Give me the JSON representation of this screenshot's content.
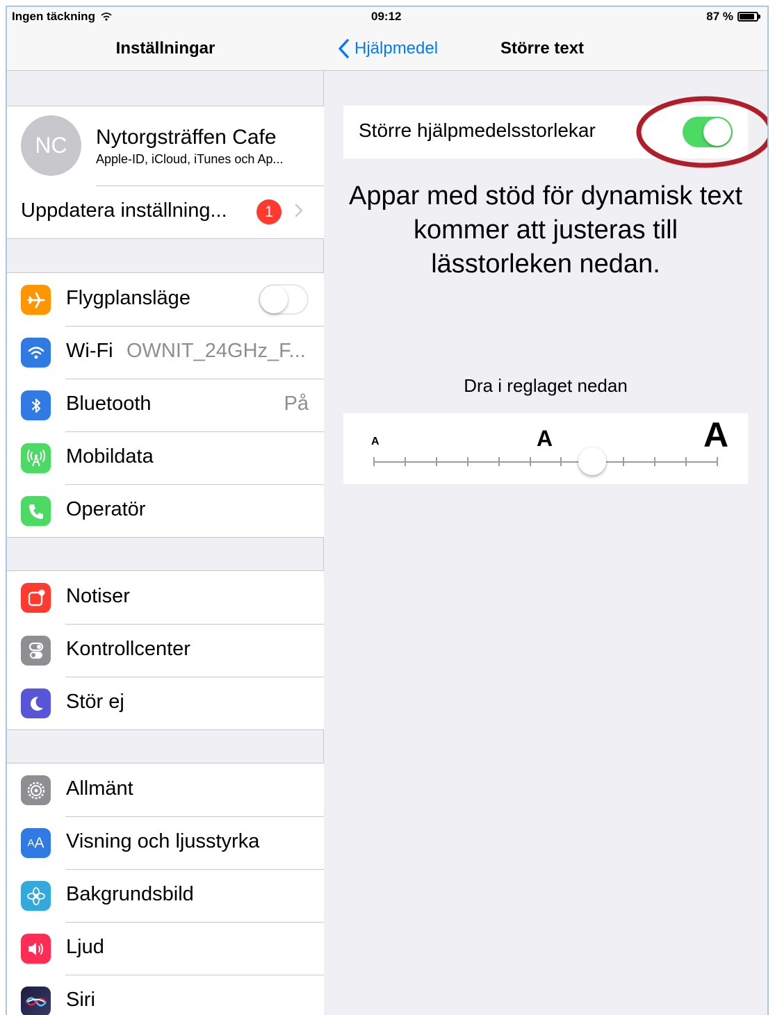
{
  "status": {
    "carrier": "Ingen täckning",
    "time": "09:12",
    "battery_percent": "87 %",
    "battery_level": 0.87
  },
  "sidebar": {
    "title": "Inställningar",
    "profile": {
      "initials": "NC",
      "name": "Nytorgsträffen Cafe",
      "subtitle": "Apple-ID, iCloud, iTunes och Ap..."
    },
    "update": {
      "label": "Uppdatera inställning...",
      "badge": "1"
    },
    "groups": [
      [
        {
          "id": "airplane",
          "label": "Flygplansläge",
          "icon": "airplane-icon",
          "color": "#ff9500",
          "toggle": false
        },
        {
          "id": "wifi",
          "label": "Wi-Fi",
          "value": "OWNIT_24GHz_F...",
          "icon": "wifi-icon",
          "color": "#2f7be3"
        },
        {
          "id": "bluetooth",
          "label": "Bluetooth",
          "value": "På",
          "icon": "bluetooth-icon",
          "color": "#2f7be3"
        },
        {
          "id": "mobildata",
          "label": "Mobildata",
          "icon": "antenna-icon",
          "color": "#4cd964"
        },
        {
          "id": "operator",
          "label": "Operatör",
          "icon": "phone-icon",
          "color": "#4cd964"
        }
      ],
      [
        {
          "id": "notiser",
          "label": "Notiser",
          "icon": "notification-icon",
          "color": "#ff3b30"
        },
        {
          "id": "kontrollcenter",
          "label": "Kontrollcenter",
          "icon": "control-center-icon",
          "color": "#8e8e93"
        },
        {
          "id": "storej",
          "label": "Stör ej",
          "icon": "moon-icon",
          "color": "#5856d6"
        }
      ],
      [
        {
          "id": "allmant",
          "label": "Allmänt",
          "icon": "gear-icon",
          "color": "#8e8e93"
        },
        {
          "id": "visning",
          "label": "Visning och ljusstyrka",
          "icon": "text-size-icon",
          "color": "#2f7be3"
        },
        {
          "id": "bakgrund",
          "label": "Bakgrundsbild",
          "icon": "flower-icon",
          "color": "#34aadc"
        },
        {
          "id": "ljud",
          "label": "Ljud",
          "icon": "speaker-icon",
          "color": "#ff2d55"
        },
        {
          "id": "siri",
          "label": "Siri",
          "icon": "siri-icon",
          "color": "#1c1c3c"
        }
      ]
    ]
  },
  "detail": {
    "back_label": "Hjälpmedel",
    "title": "Större text",
    "switch_label": "Större hjälpmedelsstorlekar",
    "switch_on": true,
    "description": "Appar med stöd för dynamisk text kommer att justeras till lässtorleken nedan.",
    "slider_hint": "Dra i reglaget nedan",
    "slider": {
      "small": "A",
      "medium": "A",
      "large": "A",
      "steps": 12,
      "selected_step": 7
    },
    "accent": "#007aff",
    "annotation_color": "#b01e2a"
  }
}
